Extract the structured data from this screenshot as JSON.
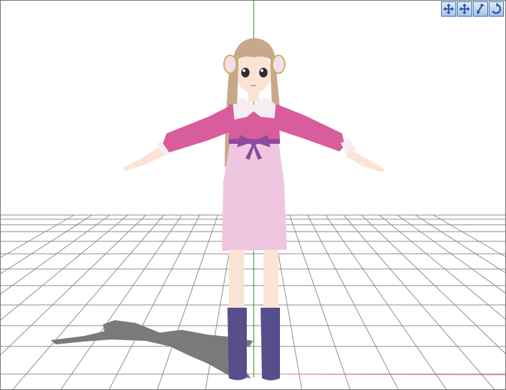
{
  "viewport": {
    "background": "#ffffff",
    "grid_color": "#8a8a8a",
    "y_axis_color": "#1f8a1f",
    "x_axis_color": "#e08080",
    "shadow_color": "#7a7a7a"
  },
  "toolbar": {
    "buttons": [
      {
        "name": "rotate-view-button",
        "icon": "rotate-arrows-icon"
      },
      {
        "name": "pan-view-button",
        "icon": "move-arrows-icon"
      },
      {
        "name": "zoom-view-button",
        "icon": "zoom-arrow-icon"
      },
      {
        "name": "reset-view-button",
        "icon": "circular-arrow-icon"
      }
    ]
  },
  "model": {
    "name": "pink-dress-girl",
    "colors": {
      "hair": "#c7a88c",
      "skin": "#fbe4d6",
      "top": "#d95c9c",
      "collar": "#f4eef2",
      "bow": "#8e4a9c",
      "skirt": "#efc6e0",
      "boots": "#574f8c"
    }
  }
}
